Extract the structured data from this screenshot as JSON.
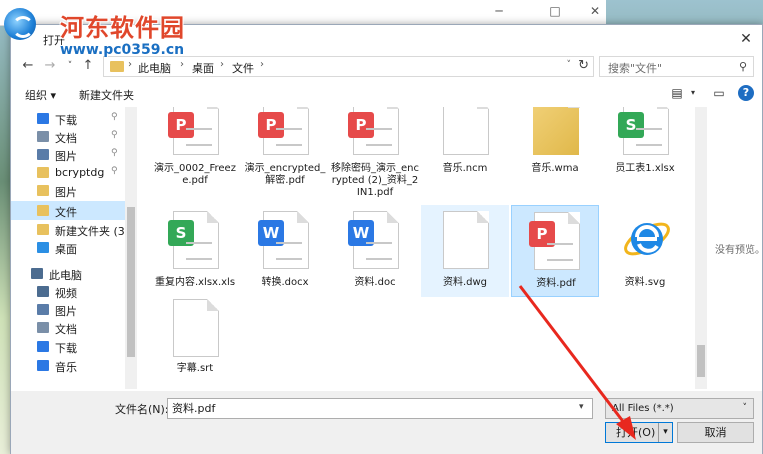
{
  "watermark": {
    "title": "河东软件园",
    "url": "www.pc0359.cn"
  },
  "dialog": {
    "title": "打开"
  },
  "breadcrumb": [
    "此电脑",
    "桌面",
    "文件"
  ],
  "search": {
    "placeholder": "搜索\"文件\""
  },
  "toolbar": {
    "organize": "组织 ▾",
    "new_folder": "新建文件夹"
  },
  "nav_items": [
    {
      "label": "下载",
      "icon": "download-icon",
      "pinned": true
    },
    {
      "label": "文档",
      "icon": "document-icon",
      "pinned": true
    },
    {
      "label": "图片",
      "icon": "picture-icon",
      "pinned": true
    },
    {
      "label": "bcryptdg",
      "icon": "folder-icon",
      "pinned": true
    },
    {
      "label": "图片",
      "icon": "folder-icon",
      "pinned": false
    },
    {
      "label": "文件",
      "icon": "folder-icon",
      "pinned": false,
      "selected": true
    },
    {
      "label": "新建文件夹 (3)",
      "icon": "folder-icon",
      "pinned": false
    },
    {
      "label": "桌面",
      "icon": "desktop-icon",
      "pinned": false
    },
    {
      "label": "此电脑",
      "icon": "computer-icon",
      "pinned": false
    },
    {
      "label": "视频",
      "icon": "video-icon",
      "pinned": false
    },
    {
      "label": "图片",
      "icon": "picture-icon",
      "pinned": false
    },
    {
      "label": "文档",
      "icon": "document-icon",
      "pinned": false
    },
    {
      "label": "下载",
      "icon": "download-icon",
      "pinned": false
    },
    {
      "label": "音乐",
      "icon": "music-icon",
      "pinned": false
    }
  ],
  "files": [
    {
      "name": "演示_0002_Freeze.pdf",
      "kind": "pdf"
    },
    {
      "name": "演示_encrypted_解密.pdf",
      "kind": "pdf"
    },
    {
      "name": "移除密码_演示_encrypted (2)_资料_2IN1.pdf",
      "kind": "pdf"
    },
    {
      "name": "音乐.ncm",
      "kind": "blank"
    },
    {
      "name": "音乐.wma",
      "kind": "media"
    },
    {
      "name": "员工表1.xlsx",
      "kind": "xls"
    },
    {
      "name": "重复内容.xlsx.xls",
      "kind": "xls"
    },
    {
      "name": "转换.docx",
      "kind": "doc"
    },
    {
      "name": "资料.doc",
      "kind": "doc"
    },
    {
      "name": "资料.dwg",
      "kind": "blank",
      "state": "hover"
    },
    {
      "name": "资料.pdf",
      "kind": "pdf",
      "state": "selected"
    },
    {
      "name": "资料.svg",
      "kind": "ie"
    },
    {
      "name": "字幕.srt",
      "kind": "blank"
    }
  ],
  "preview_text": "没有预览。",
  "bottom": {
    "filename_label": "文件名(N):",
    "filename_value": "资料.pdf",
    "filter": "All Files (*.*)",
    "open": "打开(O)",
    "cancel": "取消"
  },
  "colors": {
    "pdf": "#e64a4a",
    "xls": "#33a857",
    "doc": "#2b78e4",
    "selection": "#cce8ff",
    "arrow": "#e8281e"
  }
}
